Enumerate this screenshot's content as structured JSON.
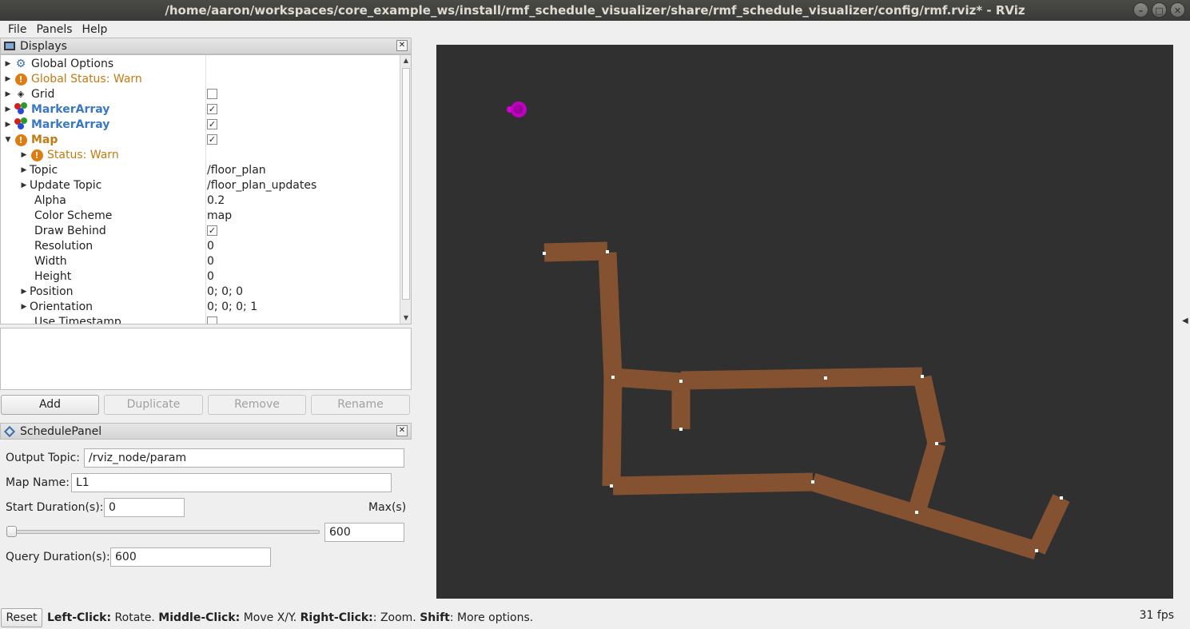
{
  "window": {
    "title": "/home/aaron/workspaces/core_example_ws/install/rmf_schedule_visualizer/share/rmf_schedule_visualizer/config/rmf.rviz* - RViz",
    "buttons": [
      "minimize",
      "maximize",
      "close"
    ]
  },
  "menu": {
    "file": "File",
    "panels": "Panels",
    "help": "Help"
  },
  "displays": {
    "title": "Displays",
    "rows": [
      {
        "label": "Global Options",
        "value": ""
      },
      {
        "label": "Global Status: Warn",
        "value": ""
      },
      {
        "label": "Grid",
        "value": ""
      },
      {
        "label": "MarkerArray",
        "value": ""
      },
      {
        "label": "MarkerArray",
        "value": ""
      },
      {
        "label": "Map",
        "value": ""
      },
      {
        "label": "Status: Warn",
        "value": ""
      },
      {
        "label": "Topic",
        "value": "/floor_plan"
      },
      {
        "label": "Update Topic",
        "value": "/floor_plan_updates"
      },
      {
        "label": "Alpha",
        "value": "0.2"
      },
      {
        "label": "Color Scheme",
        "value": "map"
      },
      {
        "label": "Draw Behind",
        "value": ""
      },
      {
        "label": "Resolution",
        "value": "0"
      },
      {
        "label": "Width",
        "value": "0"
      },
      {
        "label": "Height",
        "value": "0"
      },
      {
        "label": "Position",
        "value": "0; 0; 0"
      },
      {
        "label": "Orientation",
        "value": "0; 0; 0; 1"
      },
      {
        "label": "Use Timestamp",
        "value": ""
      }
    ],
    "checkboxes": {
      "grid": false,
      "marker1": true,
      "marker2": true,
      "map": true,
      "draw_behind": true,
      "use_timestamp": false
    },
    "buttons": {
      "add": "Add",
      "duplicate": "Duplicate",
      "remove": "Remove",
      "rename": "Rename"
    }
  },
  "schedule": {
    "title": "SchedulePanel",
    "output_topic_label": "Output Topic:",
    "output_topic_value": "/rviz_node/param",
    "map_name_label": "Map Name:",
    "map_name_value": "L1",
    "start_duration_label": "Start Duration(s):",
    "start_duration_value": "0",
    "max_label": "Max(s)",
    "max_value": "600",
    "slider_value": 0,
    "query_duration_label": "Query Duration(s):",
    "query_duration_value": "600"
  },
  "status": {
    "reset": "Reset",
    "b1": "Left-Click:",
    "t1": " Rotate. ",
    "b2": "Middle-Click:",
    "t2": " Move X/Y. ",
    "b3": "Right-Click:",
    "t3": ": Zoom. ",
    "b4": "Shift",
    "t4": ": More options.",
    "fps": "31 fps"
  },
  "colors": {
    "render_bg": "#303030",
    "lane": "#8a5432",
    "robot": "#c000c0",
    "warn": "#e07b10",
    "marker": "#3a78c2"
  }
}
